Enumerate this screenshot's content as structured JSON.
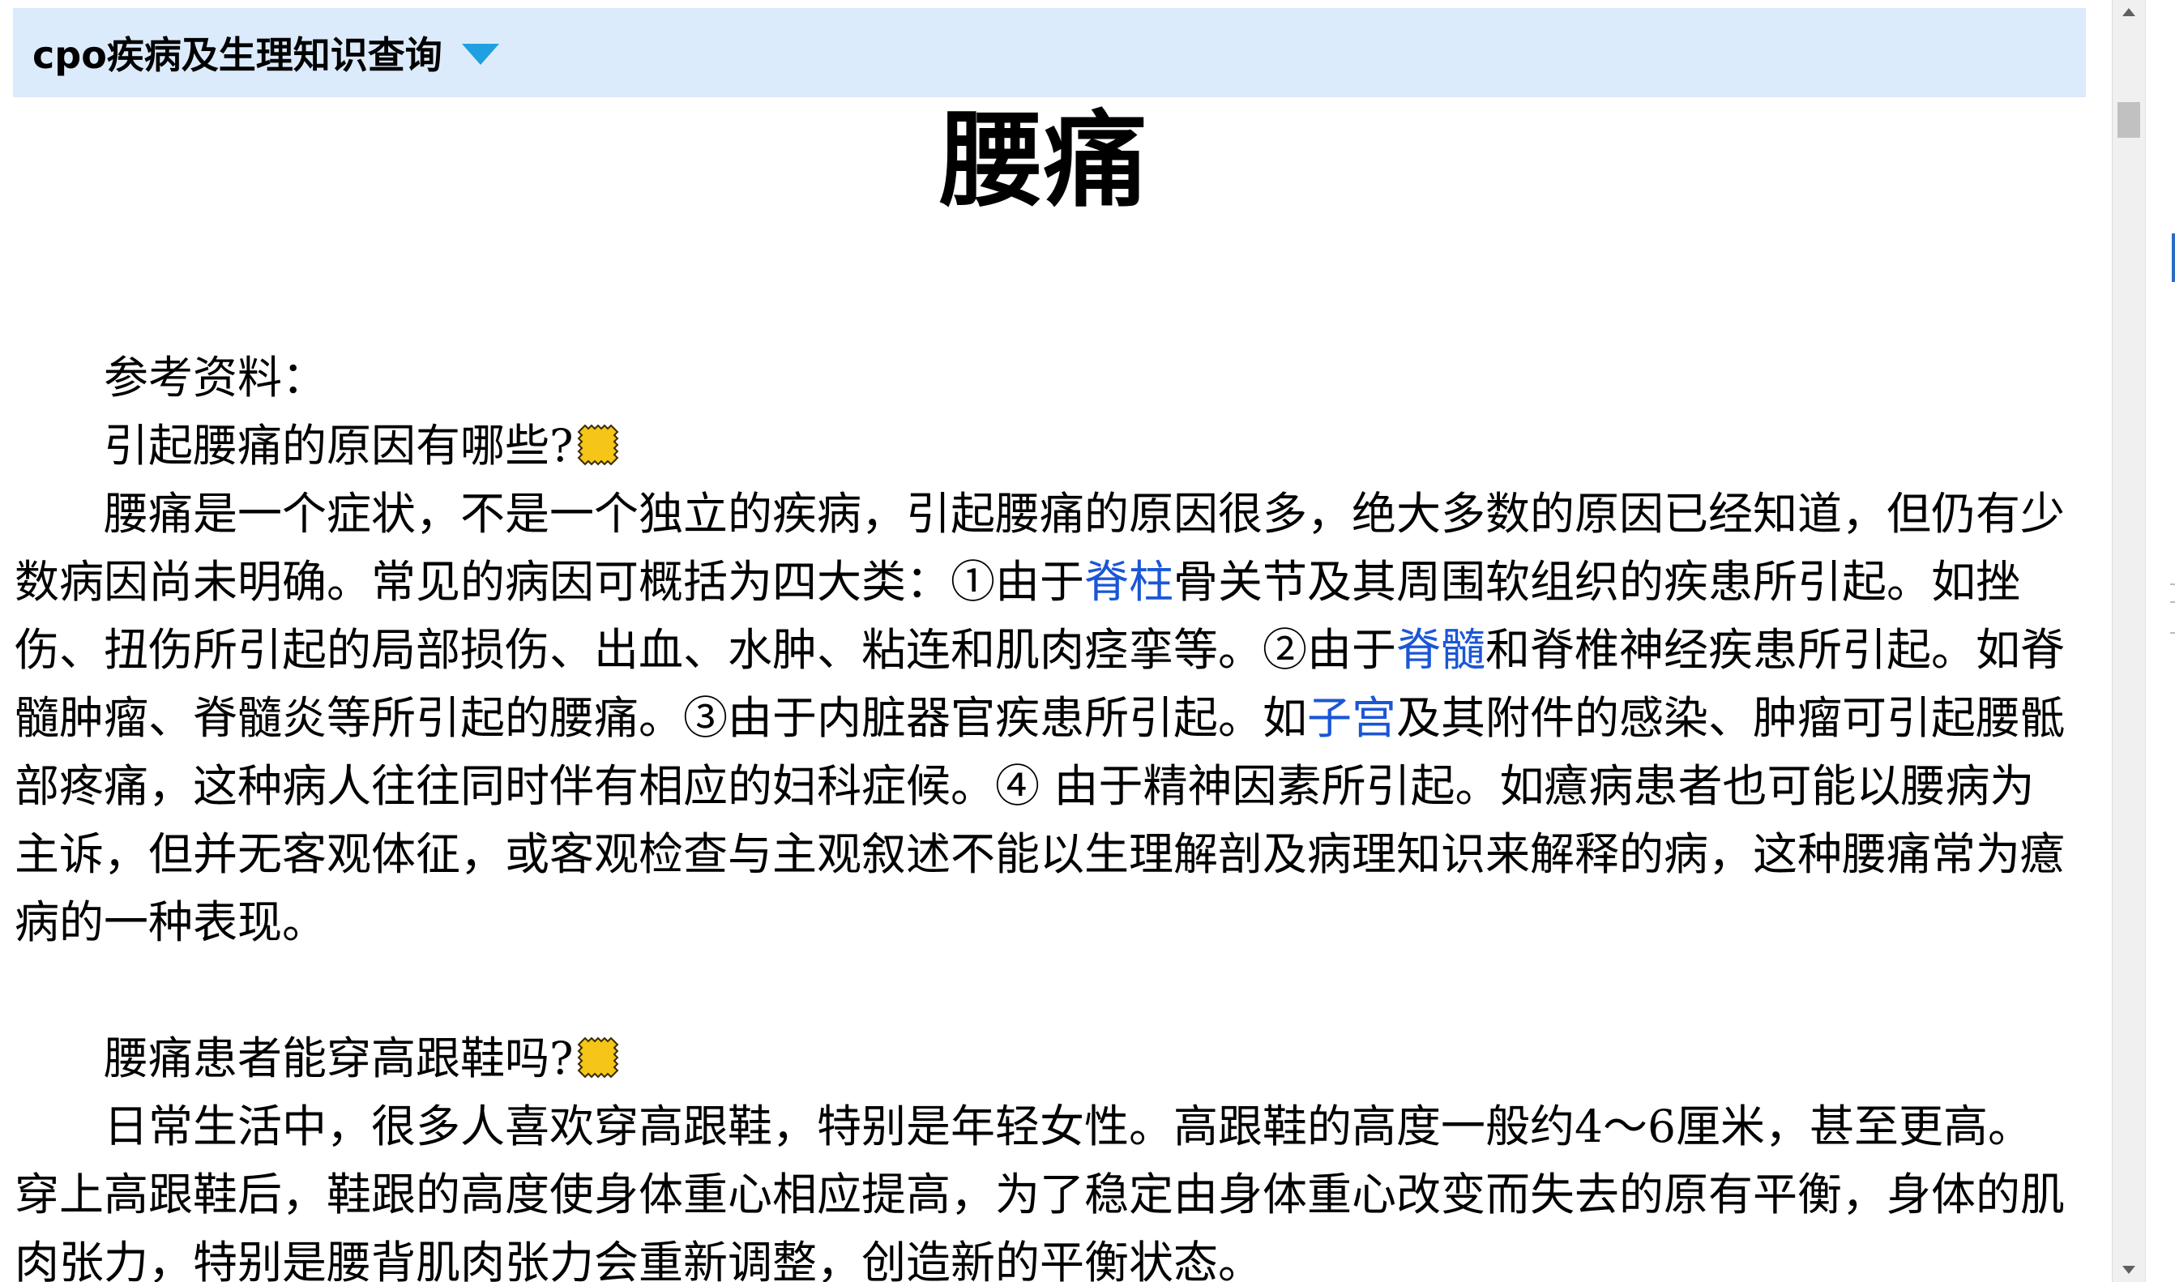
{
  "header": {
    "title": "cpo疾病及生理知识查询"
  },
  "article": {
    "title": "腰痛",
    "ref_label": "参考资料：",
    "q1": "引起腰痛的原因有哪些?",
    "p1": {
      "t1": "腰痛是一个症状，不是一个独立的疾病，引起腰痛的原因很多，绝大多数的原因已经知道，但仍有少数病因尚未明确。常见的病因可概括为四大类：①由于",
      "link1": "脊柱",
      "t2": "骨关节及其周围软组织的疾患所引起。如挫伤、扭伤所引起的局部损伤、出血、水肿、粘连和肌肉痉挛等。②由于",
      "link2": "脊髓",
      "t3": "和脊椎神经疾患所引起。如脊髓肿瘤、脊髓炎等所引起的腰痛。③由于内脏器官疾患所引起。如",
      "link3": "子宫",
      "t4": "及其附件的感染、肿瘤可引起腰骶部疼痛，这种病人往往同时伴有相应的妇科症候。④ 由于精神因素所引起。如癔病患者也可能以腰病为主诉，但并无客观体征，或客观检查与主观叙述不能以生理解剖及病理知识来解释的病，这种腰痛常为癔病的一种表现。"
    },
    "q2": "腰痛患者能穿高跟鞋吗?",
    "p2": "日常生活中，很多人喜欢穿高跟鞋，特别是年轻女性。高跟鞋的高度一般约4～6厘米，甚至更高。穿上高跟鞋后，鞋跟的高度使身体重心相应提高，为了稳定由身体重心改变而失去的原有平衡，身体的肌肉张力，特别是腰背肌肉张力会重新调整，创造新的平衡状态。"
  },
  "colors": {
    "header_bg": "#dcebfb",
    "dropdown_arrow": "#1fa0e0",
    "link": "#1a56d6",
    "icon_fill": "#f5c518"
  }
}
